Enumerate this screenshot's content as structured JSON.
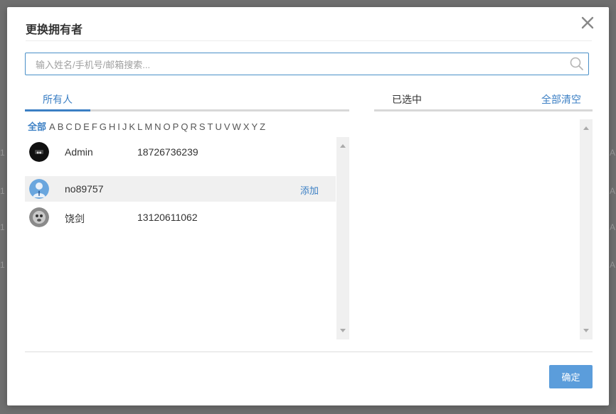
{
  "dialog": {
    "title": "更换拥有者",
    "search_placeholder": "输入姓名/手机号/邮箱搜索...",
    "close_icon": "close-icon",
    "ok_label": "确定"
  },
  "left_panel": {
    "tab_label": "所有人",
    "letters_all": "全部",
    "letters": [
      "A",
      "B",
      "C",
      "D",
      "E",
      "F",
      "G",
      "H",
      "I",
      "J",
      "K",
      "L",
      "M",
      "N",
      "O",
      "P",
      "Q",
      "R",
      "S",
      "T",
      "U",
      "V",
      "W",
      "X",
      "Y",
      "Z"
    ],
    "users": [
      {
        "name": "Admin",
        "phone": "18726736239",
        "action": ""
      },
      {
        "name": "no89757",
        "phone": "",
        "action": "添加"
      },
      {
        "name": "饶剑",
        "phone": "13120611062",
        "action": ""
      }
    ]
  },
  "right_panel": {
    "title": "已选中",
    "clear_label": "全部清空"
  },
  "colors": {
    "accent": "#3b7fc4",
    "button": "#5b9ddb"
  }
}
